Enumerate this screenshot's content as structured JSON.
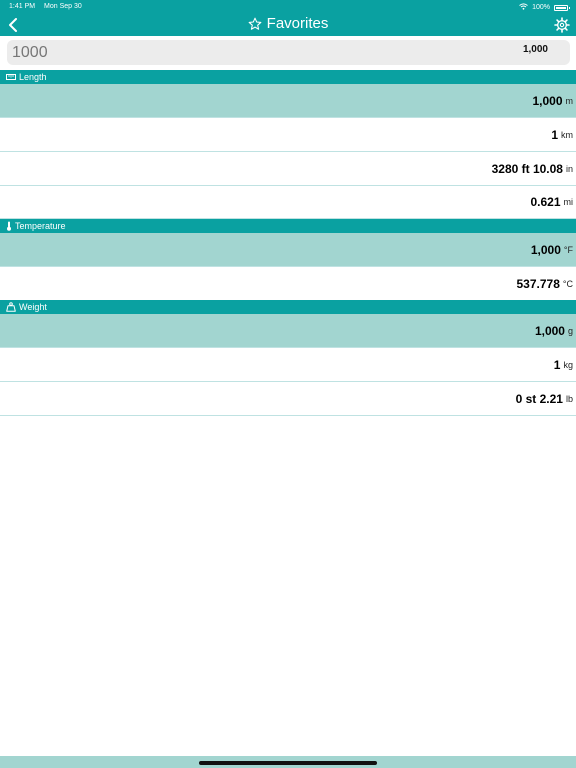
{
  "status": {
    "time": "1:41 PM",
    "date": "Mon Sep 30",
    "battery": "100%"
  },
  "nav": {
    "title": "Favorites"
  },
  "input": {
    "value": "1000",
    "formatted": "1,000"
  },
  "sections": {
    "length": {
      "title": "Length",
      "rows": [
        {
          "value": "1,000",
          "unit": "m"
        },
        {
          "value": "1",
          "unit": "km"
        },
        {
          "value": "3280 ft 10.08",
          "unit": "in"
        },
        {
          "value": "0.621",
          "unit": "mi"
        }
      ]
    },
    "temperature": {
      "title": "Temperature",
      "rows": [
        {
          "value": "1,000",
          "unit": "°F"
        },
        {
          "value": "537.778",
          "unit": "°C"
        }
      ]
    },
    "weight": {
      "title": "Weight",
      "rows": [
        {
          "value": "1,000",
          "unit": "g"
        },
        {
          "value": "1",
          "unit": "kg"
        },
        {
          "value": "0 st 2.21",
          "unit": "lb"
        }
      ]
    }
  },
  "colors": {
    "accent": "#0aa1a1",
    "highlight": "#a2d5d0",
    "divider": "#bfe2e2"
  },
  "icons": {
    "back": "chevron-left-icon",
    "title": "star-icon",
    "settings": "gear-icon",
    "length": "ruler-icon",
    "temperature": "thermometer-icon",
    "weight": "weight-icon"
  }
}
